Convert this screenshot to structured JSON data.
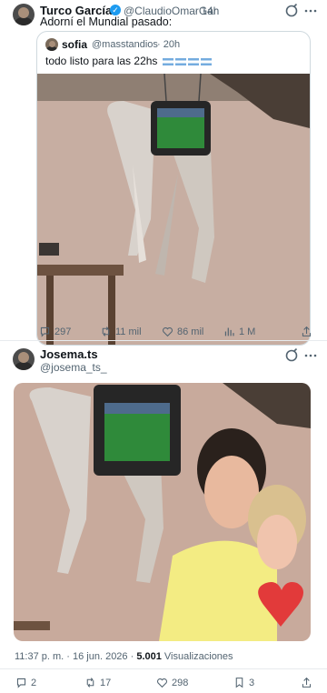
{
  "tweet1": {
    "name": "Turco García",
    "handle": "@ClaudioOmarGar",
    "time": "· 14h",
    "text": "Adorní el Mundial pasado:",
    "quote": {
      "name": "sofia",
      "handle": "@masstandios",
      "time": "· 20h",
      "text": "todo listo para las 22hs",
      "flags_emoji": "🇦🇷🇦🇷🇦🇷🇦🇷"
    },
    "metrics": {
      "replies": "297",
      "retweets": "11 mil",
      "likes": "86 mil",
      "views": "1 M"
    }
  },
  "tweet2": {
    "name": "Josema.ts",
    "handle": "@josema_ts_",
    "meta_time": "11:37 p. m. · 16 jun. 2026 ·",
    "views_count": "5.001",
    "views_label": "Visualizaciones",
    "metrics": {
      "replies": "2",
      "retweets": "17",
      "likes": "298",
      "bookmarks": "3"
    }
  },
  "colors": {
    "accent": "#1d9bf0",
    "muted": "#536471",
    "border": "#cfd9de"
  },
  "icons": [
    "verified-icon",
    "grok-icon",
    "more-icon",
    "reply-icon",
    "retweet-icon",
    "like-icon",
    "views-icon",
    "share-icon",
    "bookmark-icon"
  ]
}
